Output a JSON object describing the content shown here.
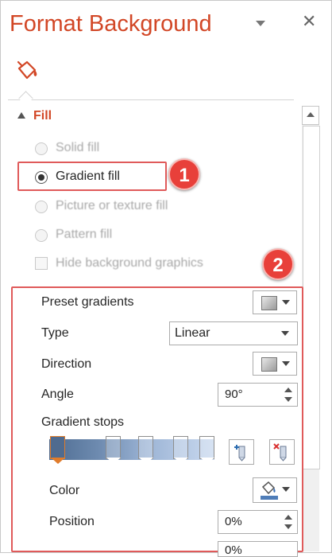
{
  "pane": {
    "title": "Format Background",
    "close_glyph": "✕",
    "tab_icon": "paint-bucket-icon",
    "accent": "#d24726"
  },
  "fill_section": {
    "label": "Fill",
    "options": {
      "solid": "Solid fill",
      "gradient": "Gradient fill",
      "picture": "Picture or texture fill",
      "pattern": "Pattern fill"
    },
    "selected": "gradient",
    "hide_graphics": "Hide background graphics"
  },
  "gradient": {
    "preset_label": "Preset gradients",
    "type_label": "Type",
    "type_value": "Linear",
    "direction_label": "Direction",
    "angle_label": "Angle",
    "angle_value": "90°",
    "stops_label": "Gradient stops",
    "color_label": "Color",
    "position_label": "Position",
    "position_value": "0%",
    "transparency_value": "0%"
  },
  "callouts": [
    "1",
    "2"
  ]
}
